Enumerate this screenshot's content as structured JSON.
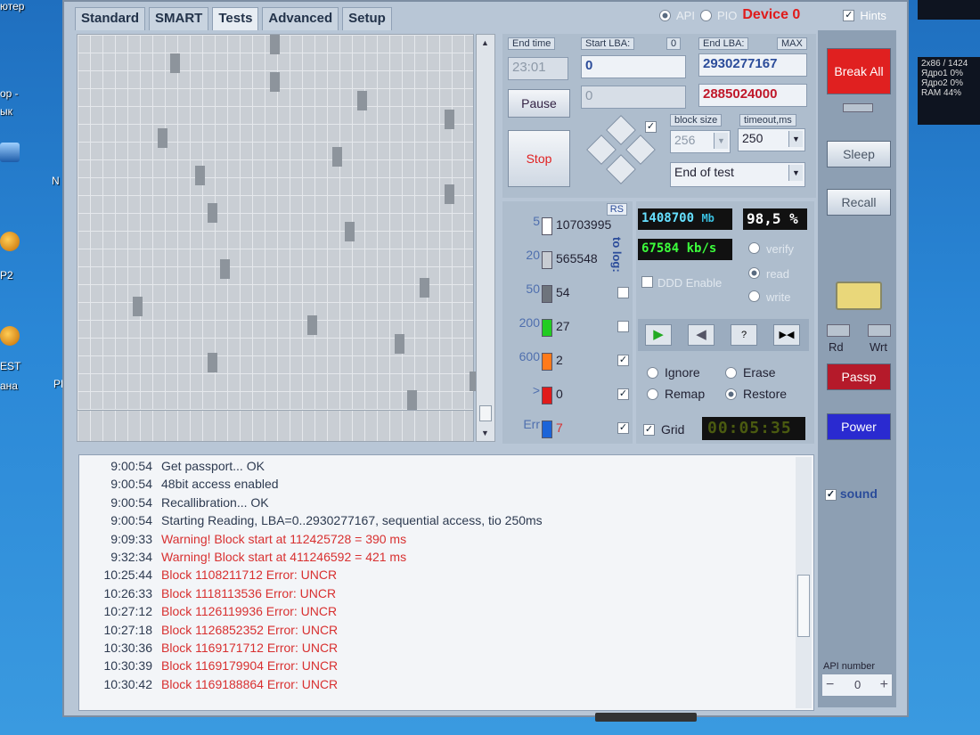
{
  "desktop": {
    "left_labels": [
      "ютер",
      "ор -",
      "ык",
      "P2",
      "EST",
      "ана"
    ],
    "partial_m": "N",
    "partial_ph": "PH"
  },
  "tabs": [
    "Standard",
    "SMART",
    "Tests",
    "Advanced",
    "Setup"
  ],
  "active_tab": "Tests",
  "header": {
    "api_label": "API",
    "pio_label": "PIO",
    "device_label": "Device 0",
    "hints_label": "Hints"
  },
  "controls": {
    "end_time_label": "End time",
    "end_time_value": "23:01",
    "start_lba_label": "Start LBA:",
    "start_lba_value": "0",
    "start_lba_zero": "0",
    "end_lba_label": "End LBA:",
    "end_lba_max": "MAX",
    "end_lba_value": "2930277167",
    "current_lba_start": "0",
    "current_lba": "2885024000",
    "pause_label": "Pause",
    "stop_label": "Stop",
    "block_size_label": "block size",
    "block_size_value": "256",
    "timeout_label": "timeout,ms",
    "timeout_value": "250",
    "end_action_value": "End of test"
  },
  "stats": {
    "rs_label": "RS",
    "to_log_label": "to log:",
    "rows": [
      {
        "threshold": "5",
        "count": "10703995",
        "color": "#ffffff"
      },
      {
        "threshold": "20",
        "count": "565548",
        "color": "#c8ccd2"
      },
      {
        "threshold": "50",
        "count": "54",
        "color": "#6e747c"
      },
      {
        "threshold": "200",
        "count": "27",
        "color": "#22cc22"
      },
      {
        "threshold": "600",
        "count": "2",
        "color": "#ff7a1a"
      },
      {
        "threshold": ">",
        "count": "0",
        "color": "#e01b1b"
      },
      {
        "threshold": "Err",
        "count": "7",
        "color": "#1c64d8"
      }
    ]
  },
  "speed": {
    "mb_value": "1408700",
    "mb_unit": "Mb",
    "percent": "98,5 %",
    "speed_value": "67584",
    "speed_unit": "kb/s",
    "verify_label": "verify",
    "read_label": "read",
    "write_label": "write",
    "ddd_label": "DDD Enable",
    "ignore_label": "Ignore",
    "erase_label": "Erase",
    "remap_label": "Remap",
    "restore_label": "Restore",
    "grid_label": "Grid",
    "timer": "00:05:35"
  },
  "right": {
    "break_all_label": "Break All",
    "sleep_label": "Sleep",
    "recall_label": "Recall",
    "rd_label": "Rd",
    "wrt_label": "Wrt",
    "passp_label": "Passp",
    "power_label": "Power",
    "sound_label": "sound",
    "api_number_label": "API number",
    "api_number_value": "0",
    "minus": "−",
    "plus": "+"
  },
  "log": [
    {
      "time": "9:00:54",
      "msg": "Get passport... OK",
      "type": "info"
    },
    {
      "time": "9:00:54",
      "msg": "48bit access enabled",
      "type": "info"
    },
    {
      "time": "9:00:54",
      "msg": "Recallibration... OK",
      "type": "info"
    },
    {
      "time": "9:00:54",
      "msg": "Starting Reading, LBA=0..2930277167, sequential access, tio 250ms",
      "type": "info"
    },
    {
      "time": "9:09:33",
      "msg": "Warning! Block start at 112425728 = 390 ms",
      "type": "warn"
    },
    {
      "time": "9:32:34",
      "msg": "Warning! Block start at 411246592 = 421 ms",
      "type": "warn"
    },
    {
      "time": "10:25:44",
      "msg": "Block 1108211712 Error: UNCR",
      "type": "error"
    },
    {
      "time": "10:26:33",
      "msg": "Block 1118113536 Error: UNCR",
      "type": "error"
    },
    {
      "time": "10:27:12",
      "msg": "Block 1126119936 Error: UNCR",
      "type": "error"
    },
    {
      "time": "10:27:18",
      "msg": "Block 1126852352 Error: UNCR",
      "type": "error"
    },
    {
      "time": "10:30:36",
      "msg": "Block 1169171712 Error: UNCR",
      "type": "error"
    },
    {
      "time": "10:30:39",
      "msg": "Block 1169179904 Error: UNCR",
      "type": "error"
    },
    {
      "time": "10:30:42",
      "msg": "Block 1169188864 Error: UNCR",
      "type": "error"
    }
  ],
  "perf": {
    "title": "2x86 / 1424",
    "line1_label": "Ядро1",
    "line1_value": "0%",
    "line2_label": "Ядро2",
    "line2_value": "0%",
    "line3_label": "RAM",
    "line3_value": "44%"
  }
}
